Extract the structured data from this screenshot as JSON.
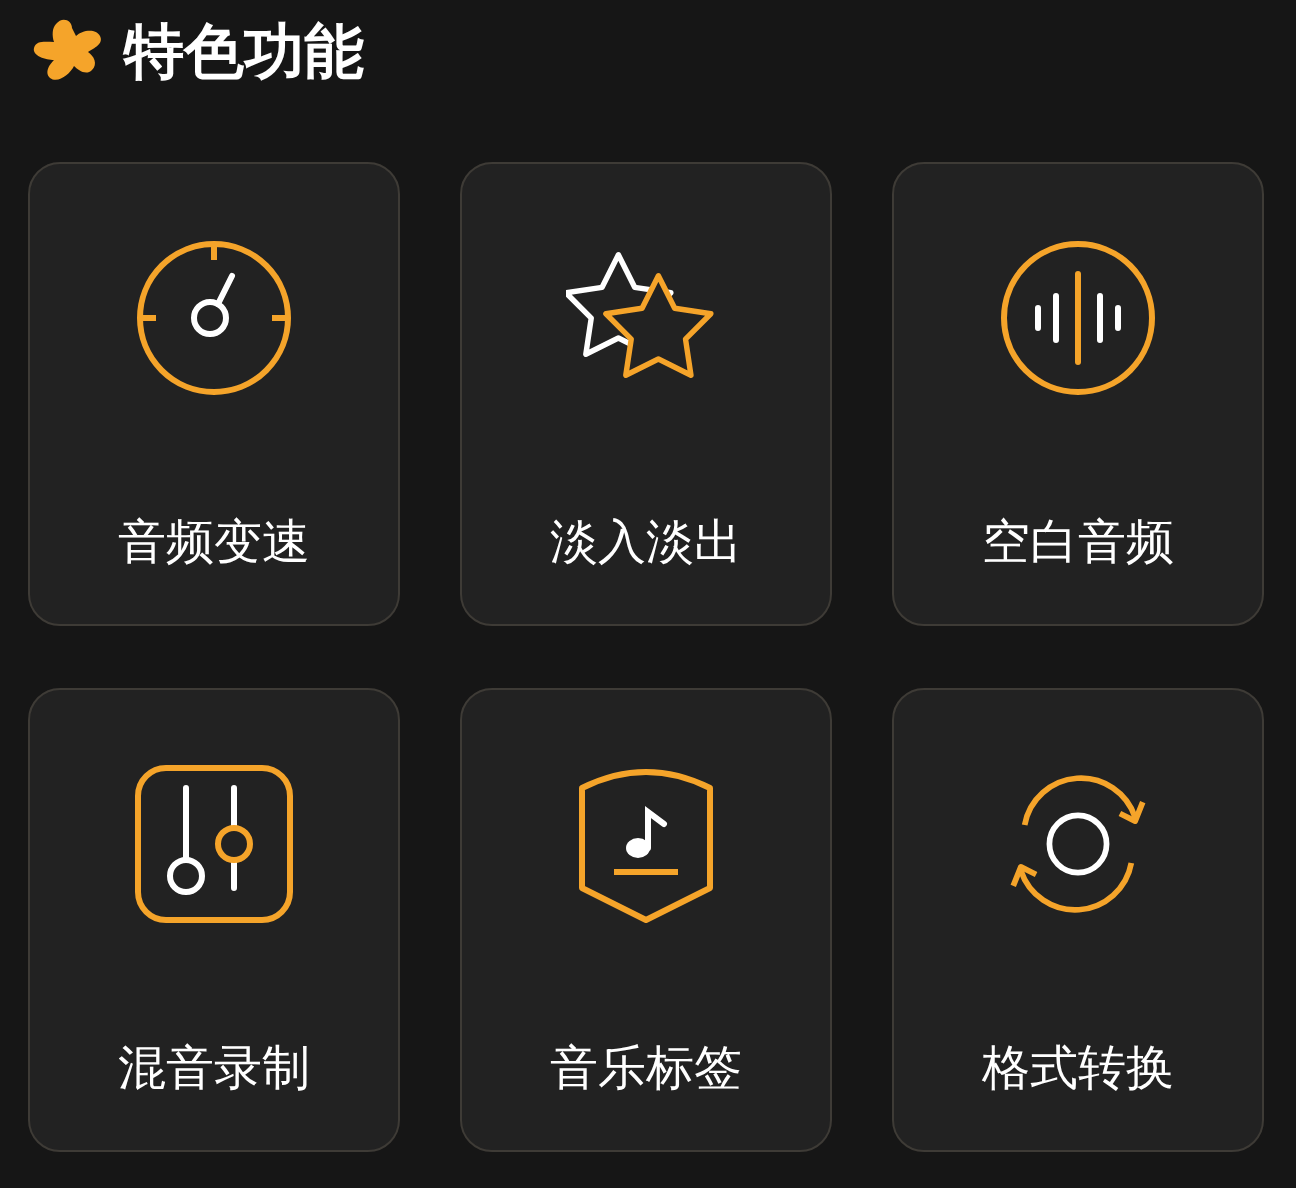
{
  "section": {
    "title": "特色功能"
  },
  "features": [
    {
      "kind": "speed",
      "label": "音频变速"
    },
    {
      "kind": "fade",
      "label": "淡入淡出"
    },
    {
      "kind": "silence",
      "label": "空白音频"
    },
    {
      "kind": "mixer",
      "label": "混音录制"
    },
    {
      "kind": "tag",
      "label": "音乐标签"
    },
    {
      "kind": "convert",
      "label": "格式转换"
    }
  ]
}
